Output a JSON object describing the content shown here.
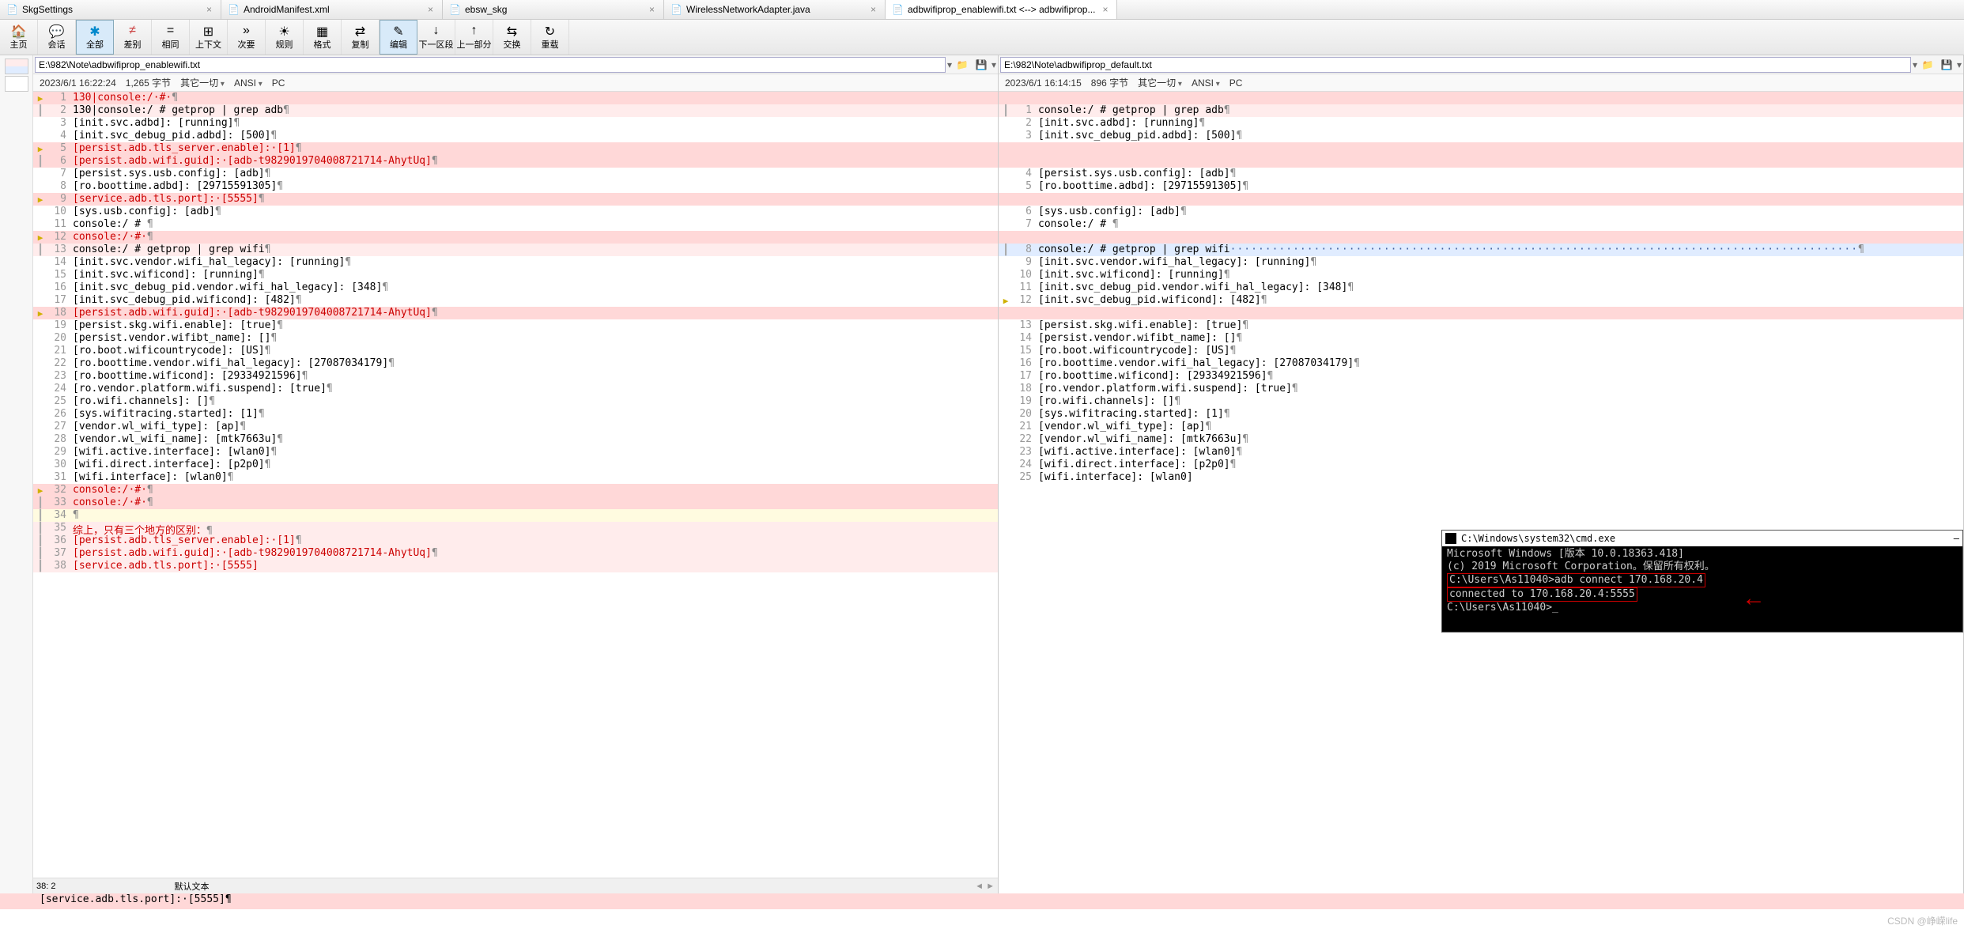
{
  "tabs": [
    {
      "label": "SkgSettings",
      "icon": "file"
    },
    {
      "label": "AndroidManifest.xml",
      "icon": "xml"
    },
    {
      "label": "ebsw_skg",
      "icon": "file"
    },
    {
      "label": "WirelessNetworkAdapter.java",
      "icon": "java"
    },
    {
      "label": "adbwifiprop_enablewifi.txt <--> adbwifiprop...",
      "icon": "diff",
      "active": true
    }
  ],
  "toolbar": [
    {
      "label": "主页",
      "key": "home"
    },
    {
      "label": "会话",
      "key": "session"
    },
    {
      "label": "全部",
      "key": "all",
      "sel": true
    },
    {
      "label": "差别",
      "key": "diff",
      "color": "#c44"
    },
    {
      "label": "相同",
      "key": "same"
    },
    {
      "label": "上下文",
      "key": "context"
    },
    {
      "label": "次要",
      "key": "minor"
    },
    {
      "label": "规则",
      "key": "rules"
    },
    {
      "label": "格式",
      "key": "format"
    },
    {
      "label": "复制",
      "key": "copy"
    },
    {
      "label": "编辑",
      "key": "edit",
      "sel": true
    },
    {
      "label": "下一区段",
      "key": "nextsec"
    },
    {
      "label": "上一部分",
      "key": "prevsec"
    },
    {
      "label": "交换",
      "key": "swap"
    },
    {
      "label": "重载",
      "key": "reload"
    }
  ],
  "left": {
    "path": "E:\\982\\Note\\adbwifiprop_enablewifi.txt",
    "info": {
      "time": "2023/6/1 16:22:24",
      "size": "1,265 字节",
      "other": "其它一切",
      "enc": "ANSI",
      "os": "PC"
    },
    "lines": [
      {
        "n": 1,
        "m": "a",
        "cls": "pink",
        "t": "130|console:/·#·",
        "red": true,
        "pilcrow": true
      },
      {
        "n": 2,
        "m": "|",
        "cls": "ltpink",
        "t": "130|console:/ # getprop | grep adb",
        "pilcrow": true
      },
      {
        "n": 3,
        "t": "[init.svc.adbd]: [running]",
        "pilcrow": true
      },
      {
        "n": 4,
        "t": "[init.svc_debug_pid.adbd]: [500]",
        "pilcrow": true
      },
      {
        "n": 5,
        "m": "a",
        "cls": "pink",
        "t": "[persist.adb.tls_server.enable]:·[1]",
        "red": true,
        "pilcrow": true
      },
      {
        "n": 6,
        "m": "|",
        "cls": "pink",
        "t": "[persist.adb.wifi.guid]:·[adb-t9829019704008721714-AhytUq]",
        "red": true,
        "pilcrow": true
      },
      {
        "n": 7,
        "t": "[persist.sys.usb.config]: [adb]",
        "pilcrow": true
      },
      {
        "n": 8,
        "t": "[ro.boottime.adbd]: [29715591305]",
        "pilcrow": true
      },
      {
        "n": 9,
        "m": "a",
        "cls": "pink",
        "t": "[service.adb.tls.port]:·[5555]",
        "red": true,
        "pilcrow": true
      },
      {
        "n": 10,
        "t": "[sys.usb.config]: [adb]",
        "pilcrow": true
      },
      {
        "n": 11,
        "t": "console:/ # ",
        "pilcrow": true
      },
      {
        "n": 12,
        "m": "a",
        "cls": "pink",
        "t": "console:/·#·",
        "red": true,
        "pilcrow": true
      },
      {
        "n": 13,
        "m": "|",
        "cls": "ltpink",
        "t": "console:/ # getprop | grep wifi",
        "pilcrow": true
      },
      {
        "n": 14,
        "t": "[init.svc.vendor.wifi_hal_legacy]: [running]",
        "pilcrow": true
      },
      {
        "n": 15,
        "t": "[init.svc.wificond]: [running]",
        "pilcrow": true
      },
      {
        "n": 16,
        "t": "[init.svc_debug_pid.vendor.wifi_hal_legacy]: [348]",
        "pilcrow": true
      },
      {
        "n": 17,
        "t": "[init.svc_debug_pid.wificond]: [482]",
        "pilcrow": true
      },
      {
        "n": 18,
        "m": "a",
        "cls": "pink",
        "t": "[persist.adb.wifi.guid]:·[adb-t9829019704008721714-AhytUq]",
        "red": true,
        "pilcrow": true
      },
      {
        "n": 19,
        "t": "[persist.skg.wifi.enable]: [true]",
        "pilcrow": true
      },
      {
        "n": 20,
        "t": "[persist.vendor.wifibt_name]: []",
        "pilcrow": true
      },
      {
        "n": 21,
        "t": "[ro.boot.wificountrycode]: [US]",
        "pilcrow": true
      },
      {
        "n": 22,
        "t": "[ro.boottime.vendor.wifi_hal_legacy]: [27087034179]",
        "pilcrow": true
      },
      {
        "n": 23,
        "t": "[ro.boottime.wificond]: [29334921596]",
        "pilcrow": true
      },
      {
        "n": 24,
        "t": "[ro.vendor.platform.wifi.suspend]: [true]",
        "pilcrow": true
      },
      {
        "n": 25,
        "t": "[ro.wifi.channels]: []",
        "pilcrow": true
      },
      {
        "n": 26,
        "t": "[sys.wifitracing.started]: [1]",
        "pilcrow": true
      },
      {
        "n": 27,
        "t": "[vendor.wl_wifi_type]: [ap]",
        "pilcrow": true
      },
      {
        "n": 28,
        "t": "[vendor.wl_wifi_name]: [mtk7663u]",
        "pilcrow": true
      },
      {
        "n": 29,
        "t": "[wifi.active.interface]: [wlan0]",
        "pilcrow": true
      },
      {
        "n": 30,
        "t": "[wifi.direct.interface]: [p2p0]",
        "pilcrow": true
      },
      {
        "n": 31,
        "t": "[wifi.interface]: [wlan0]",
        "pilcrow": true
      },
      {
        "n": 32,
        "m": "a",
        "cls": "pink",
        "t": "console:/·#·",
        "red": true,
        "pilcrow": true
      },
      {
        "n": 33,
        "m": "|",
        "cls": "pink",
        "t": "console:/·#·",
        "red": true,
        "pilcrow": true
      },
      {
        "n": 34,
        "m": "|",
        "cls": "yellow",
        "t": "",
        "pilcrow": true
      },
      {
        "n": 35,
        "m": "|",
        "cls": "ltpink",
        "t": "综上，只有三个地方的区别：",
        "red": true,
        "pilcrow": true
      },
      {
        "n": 36,
        "m": "|",
        "cls": "ltpink",
        "t": "[persist.adb.tls_server.enable]:·[1]",
        "red": true,
        "pilcrow": true
      },
      {
        "n": 37,
        "m": "|",
        "cls": "ltpink",
        "t": "[persist.adb.wifi.guid]:·[adb-t9829019704008721714-AhytUq]",
        "red": true,
        "pilcrow": true
      },
      {
        "n": 38,
        "m": "|",
        "cls": "ltpink",
        "t": "[service.adb.tls.port]:·[5555]",
        "red": true
      }
    ],
    "cursor": "38: 2",
    "syntax": "默认文本",
    "bottom_line": "[service.adb.tls.port]:·[5555]"
  },
  "right": {
    "path": "E:\\982\\Note\\adbwifiprop_default.txt",
    "info": {
      "time": "2023/6/1 16:14:15",
      "size": "896 字节",
      "other": "其它一切",
      "enc": "ANSI",
      "os": "PC"
    },
    "lines": [
      {
        "n": "",
        "cls": "pink",
        "t": ""
      },
      {
        "n": 1,
        "m": "|",
        "cls": "ltpink",
        "t": "console:/ # getprop | grep adb",
        "pilcrow": true
      },
      {
        "n": 2,
        "t": "[init.svc.adbd]: [running]",
        "pilcrow": true
      },
      {
        "n": 3,
        "t": "[init.svc_debug_pid.adbd]: [500]",
        "pilcrow": true
      },
      {
        "n": "",
        "cls": "pink",
        "t": ""
      },
      {
        "n": "",
        "cls": "pink",
        "t": ""
      },
      {
        "n": 4,
        "t": "[persist.sys.usb.config]: [adb]",
        "pilcrow": true
      },
      {
        "n": 5,
        "t": "[ro.boottime.adbd]: [29715591305]",
        "pilcrow": true
      },
      {
        "n": "",
        "cls": "pink",
        "t": ""
      },
      {
        "n": 6,
        "t": "[sys.usb.config]: [adb]",
        "pilcrow": true
      },
      {
        "n": 7,
        "t": "console:/ # ",
        "pilcrow": true
      },
      {
        "n": "",
        "cls": "pink",
        "t": ""
      },
      {
        "n": 8,
        "m": "|",
        "cls": "blue",
        "t": "console:/ # getprop | grep wifi",
        "dots": true,
        "pilcrow": true
      },
      {
        "n": 9,
        "t": "[init.svc.vendor.wifi_hal_legacy]: [running]",
        "pilcrow": true
      },
      {
        "n": 10,
        "t": "[init.svc.wificond]: [running]",
        "pilcrow": true
      },
      {
        "n": 11,
        "t": "[init.svc_debug_pid.vendor.wifi_hal_legacy]: [348]",
        "pilcrow": true
      },
      {
        "n": 12,
        "m": "a",
        "t": "[init.svc_debug_pid.wificond]: [482]",
        "pilcrow": true
      },
      {
        "n": "",
        "cls": "pink",
        "t": ""
      },
      {
        "n": 13,
        "t": "[persist.skg.wifi.enable]: [true]",
        "pilcrow": true
      },
      {
        "n": 14,
        "t": "[persist.vendor.wifibt_name]: []",
        "pilcrow": true
      },
      {
        "n": 15,
        "t": "[ro.boot.wificountrycode]: [US]",
        "pilcrow": true
      },
      {
        "n": 16,
        "t": "[ro.boottime.vendor.wifi_hal_legacy]: [27087034179]",
        "pilcrow": true
      },
      {
        "n": 17,
        "t": "[ro.boottime.wificond]: [29334921596]",
        "pilcrow": true
      },
      {
        "n": 18,
        "t": "[ro.vendor.platform.wifi.suspend]: [true]",
        "pilcrow": true
      },
      {
        "n": 19,
        "t": "[ro.wifi.channels]: []",
        "pilcrow": true
      },
      {
        "n": 20,
        "t": "[sys.wifitracing.started]: [1]",
        "pilcrow": true
      },
      {
        "n": 21,
        "t": "[vendor.wl_wifi_type]: [ap]",
        "pilcrow": true
      },
      {
        "n": 22,
        "t": "[vendor.wl_wifi_name]: [mtk7663u]",
        "pilcrow": true
      },
      {
        "n": 23,
        "t": "[wifi.active.interface]: [wlan0]",
        "pilcrow": true
      },
      {
        "n": 24,
        "t": "[wifi.direct.interface]: [p2p0]",
        "pilcrow": true
      },
      {
        "n": 25,
        "t": "[wifi.interface]: [wlan0]"
      }
    ]
  },
  "cmd": {
    "title": "C:\\Windows\\system32\\cmd.exe",
    "lines": [
      "Microsoft Windows [版本 10.0.18363.418]",
      "(c) 2019 Microsoft Corporation。保留所有权利。",
      "",
      "C:\\Users\\As11040>adb connect 170.168.20.4",
      "connected to 170.168.20.4:5555",
      "",
      "C:\\Users\\As11040>_"
    ]
  },
  "watermark": "CSDN @峥嵘life"
}
